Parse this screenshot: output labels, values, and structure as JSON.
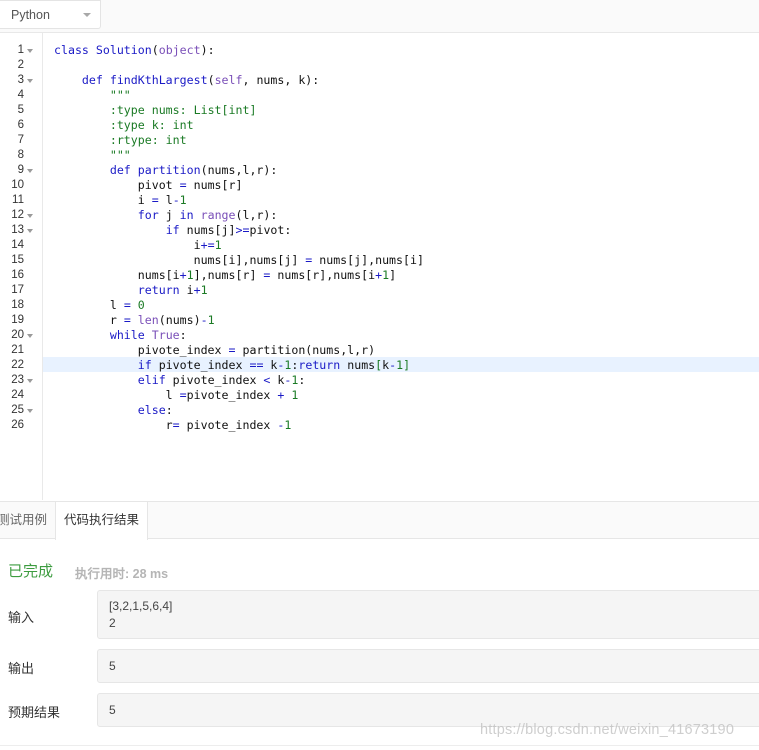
{
  "language_select": {
    "value": "Python"
  },
  "editor": {
    "line_numbers": [
      "1",
      "2",
      "3",
      "4",
      "5",
      "6",
      "7",
      "8",
      "9",
      "10",
      "11",
      "12",
      "13",
      "14",
      "15",
      "16",
      "17",
      "18",
      "19",
      "20",
      "21",
      "22",
      "23",
      "24",
      "25",
      "26"
    ],
    "folded_lines": [
      1,
      3,
      9,
      12,
      13,
      20,
      23,
      25
    ],
    "active_line": 22,
    "lines": [
      [
        [
          "k",
          "class "
        ],
        [
          "f",
          "Solution"
        ],
        [
          "p",
          "("
        ],
        [
          "b",
          "object"
        ],
        [
          "p",
          "):"
        ]
      ],
      [],
      [
        [
          "p",
          "    "
        ],
        [
          "k",
          "def "
        ],
        [
          "f",
          "findKthLargest"
        ],
        [
          "p",
          "("
        ],
        [
          "b",
          "self"
        ],
        [
          "p",
          ", nums, k):"
        ]
      ],
      [
        [
          "p",
          "        "
        ],
        [
          "s",
          "\"\"\""
        ]
      ],
      [
        [
          "p",
          "        "
        ],
        [
          "s",
          ":type nums: List[int]"
        ]
      ],
      [
        [
          "p",
          "        "
        ],
        [
          "s",
          ":type k: int"
        ]
      ],
      [
        [
          "p",
          "        "
        ],
        [
          "s",
          ":rtype: int"
        ]
      ],
      [
        [
          "p",
          "        "
        ],
        [
          "s",
          "\"\"\""
        ]
      ],
      [
        [
          "p",
          "        "
        ],
        [
          "k",
          "def "
        ],
        [
          "f",
          "partition"
        ],
        [
          "p",
          "(nums,l,r):"
        ]
      ],
      [
        [
          "p",
          "            pivot "
        ],
        [
          "o",
          "="
        ],
        [
          "p",
          " nums[r]"
        ]
      ],
      [
        [
          "p",
          "            i "
        ],
        [
          "o",
          "="
        ],
        [
          "p",
          " l"
        ],
        [
          "o",
          "-"
        ],
        [
          "n",
          "1"
        ]
      ],
      [
        [
          "p",
          "            "
        ],
        [
          "k",
          "for "
        ],
        [
          "p",
          "j "
        ],
        [
          "k",
          "in "
        ],
        [
          "b",
          "range"
        ],
        [
          "p",
          "(l,r):"
        ]
      ],
      [
        [
          "p",
          "                "
        ],
        [
          "k",
          "if "
        ],
        [
          "p",
          "nums[j]"
        ],
        [
          "o",
          ">="
        ],
        [
          "p",
          "pivot:"
        ]
      ],
      [
        [
          "p",
          "                    i"
        ],
        [
          "o",
          "+="
        ],
        [
          "n",
          "1"
        ]
      ],
      [
        [
          "p",
          "                    nums[i],nums[j] "
        ],
        [
          "o",
          "="
        ],
        [
          "p",
          " nums[j],nums[i]"
        ]
      ],
      [
        [
          "p",
          "            nums[i"
        ],
        [
          "o",
          "+"
        ],
        [
          "n",
          "1"
        ],
        [
          "p",
          "],nums[r] "
        ],
        [
          "o",
          "="
        ],
        [
          "p",
          " nums[r],nums[i"
        ],
        [
          "o",
          "+"
        ],
        [
          "n",
          "1"
        ],
        [
          "p",
          "]"
        ]
      ],
      [
        [
          "p",
          "            "
        ],
        [
          "k",
          "return "
        ],
        [
          "p",
          "i"
        ],
        [
          "o",
          "+"
        ],
        [
          "n",
          "1"
        ]
      ],
      [
        [
          "p",
          "        l "
        ],
        [
          "o",
          "="
        ],
        [
          "p",
          " "
        ],
        [
          "n",
          "0"
        ]
      ],
      [
        [
          "p",
          "        r "
        ],
        [
          "o",
          "="
        ],
        [
          "p",
          " "
        ],
        [
          "b",
          "len"
        ],
        [
          "p",
          "(nums)"
        ],
        [
          "o",
          "-"
        ],
        [
          "n",
          "1"
        ]
      ],
      [
        [
          "p",
          "        "
        ],
        [
          "k",
          "while "
        ],
        [
          "b",
          "True"
        ],
        [
          "p",
          ":"
        ]
      ],
      [
        [
          "p",
          "            pivote_index "
        ],
        [
          "o",
          "="
        ],
        [
          "p",
          " partition(nums,l,r)"
        ]
      ],
      [
        [
          "p",
          "            "
        ],
        [
          "k",
          "if "
        ],
        [
          "p",
          "pivote_index "
        ],
        [
          "o",
          "=="
        ],
        [
          "p",
          " k"
        ],
        [
          "o",
          "-"
        ],
        [
          "n",
          "1"
        ],
        [
          "p",
          ":"
        ],
        [
          "k",
          "return "
        ],
        [
          "p",
          "nums"
        ],
        [
          "s",
          "["
        ],
        [
          "p",
          "k"
        ],
        [
          "o",
          "-"
        ],
        [
          "n",
          "1"
        ],
        [
          "s",
          "]"
        ]
      ],
      [
        [
          "p",
          "            "
        ],
        [
          "k",
          "elif "
        ],
        [
          "p",
          "pivote_index "
        ],
        [
          "o",
          "<"
        ],
        [
          "p",
          " k"
        ],
        [
          "o",
          "-"
        ],
        [
          "n",
          "1"
        ],
        [
          "p",
          ":"
        ]
      ],
      [
        [
          "p",
          "                l "
        ],
        [
          "o",
          "="
        ],
        [
          "p",
          "pivote_index "
        ],
        [
          "o",
          "+"
        ],
        [
          "p",
          " "
        ],
        [
          "n",
          "1"
        ]
      ],
      [
        [
          "p",
          "            "
        ],
        [
          "k",
          "else"
        ],
        [
          "p",
          ":"
        ]
      ],
      [
        [
          "p",
          "                r"
        ],
        [
          "o",
          "="
        ],
        [
          "p",
          " pivote_index "
        ],
        [
          "o",
          "-"
        ],
        [
          "n",
          "1"
        ]
      ]
    ]
  },
  "tabs": {
    "testcase": "测试用例",
    "result": "代码执行结果"
  },
  "result": {
    "status": "已完成",
    "runtime": "执行用时: 28 ms",
    "input_label": "输入",
    "input_lines": [
      "[3,2,1,5,6,4]",
      "2"
    ],
    "output_label": "输出",
    "output_value": "5",
    "expected_label": "预期结果",
    "expected_value": "5"
  },
  "watermark": "https://blog.csdn.net/weixin_41673190",
  "colors": {
    "status_green": "#3d9c40",
    "keyword_blue": "#1a1ac6",
    "string_green": "#1a7a24",
    "builtin_purple": "#7a4fb8"
  }
}
